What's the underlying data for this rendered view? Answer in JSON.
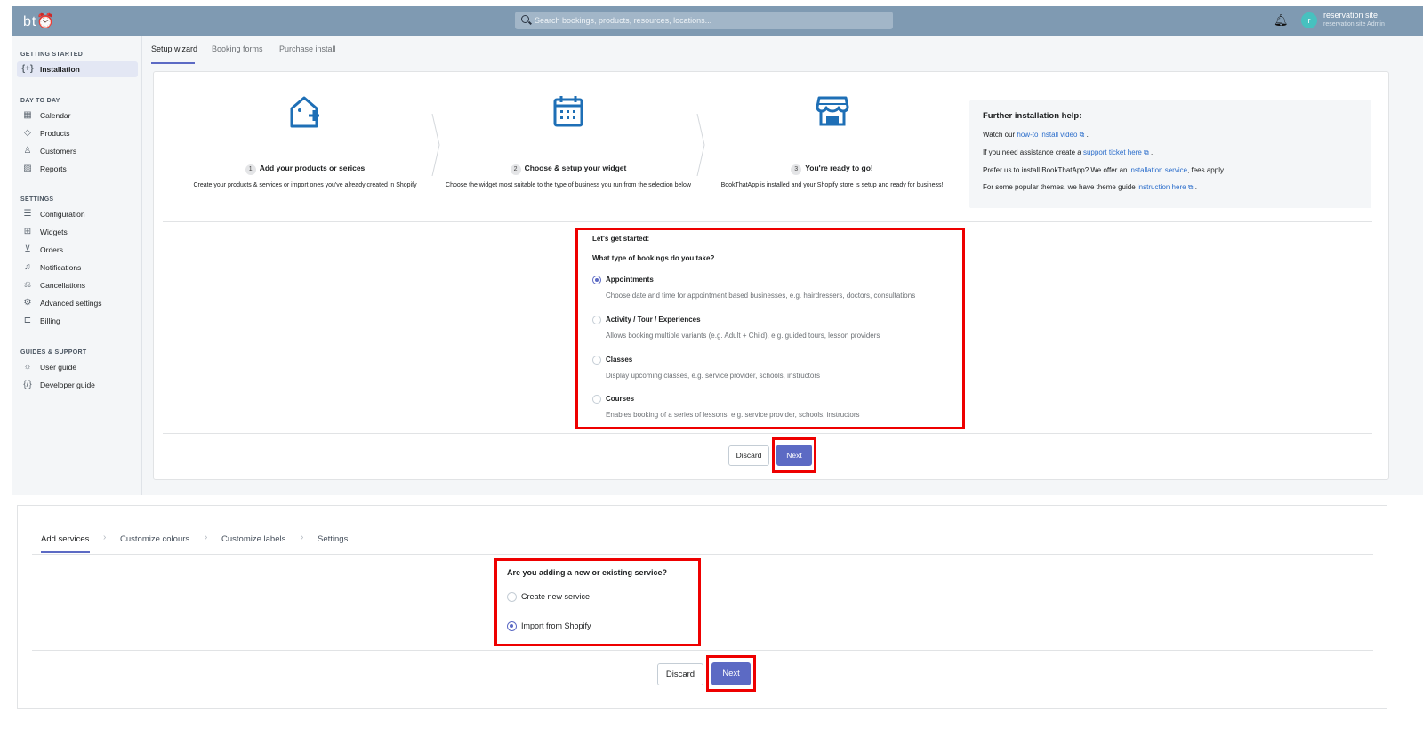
{
  "app": {
    "logo": "bt⏰",
    "search_placeholder": "Search bookings, products, resources, locations...",
    "user_initial": "r",
    "user_name": "reservation site",
    "user_role": "reservation site Admin"
  },
  "sidebar": {
    "sections": [
      {
        "title": "GETTING STARTED",
        "items": [
          {
            "label": "Installation",
            "icon": "brackets-plus-icon",
            "glyph": "{+}"
          }
        ]
      },
      {
        "title": "DAY TO DAY",
        "items": [
          {
            "label": "Calendar",
            "icon": "calendar-icon",
            "glyph": "▦"
          },
          {
            "label": "Products",
            "icon": "tag-icon",
            "glyph": "◇"
          },
          {
            "label": "Customers",
            "icon": "person-icon",
            "glyph": "♙"
          },
          {
            "label": "Reports",
            "icon": "chart-icon",
            "glyph": "▨"
          }
        ]
      },
      {
        "title": "SETTINGS",
        "items": [
          {
            "label": "Configuration",
            "icon": "sliders-icon",
            "glyph": "☰"
          },
          {
            "label": "Widgets",
            "icon": "widgets-icon",
            "glyph": "⊞"
          },
          {
            "label": "Orders",
            "icon": "download-box-icon",
            "glyph": "⊻"
          },
          {
            "label": "Notifications",
            "icon": "bell-icon",
            "glyph": "♫"
          },
          {
            "label": "Cancellations",
            "icon": "return-icon",
            "glyph": "⎌"
          },
          {
            "label": "Advanced settings",
            "icon": "gear-icon",
            "glyph": "⚙"
          },
          {
            "label": "Billing",
            "icon": "cart-icon",
            "glyph": "⊏"
          }
        ]
      },
      {
        "title": "GUIDES & SUPPORT",
        "items": [
          {
            "label": "User guide",
            "icon": "lightbulb-icon",
            "glyph": "☼"
          },
          {
            "label": "Developer guide",
            "icon": "code-icon",
            "glyph": "{/}"
          }
        ]
      }
    ]
  },
  "tabs": [
    "Setup wizard",
    "Booking forms",
    "Purchase install"
  ],
  "steps": [
    {
      "num": "1",
      "title": "Add your products or serices",
      "desc": "Create your products & services or import ones you've already created in Shopify"
    },
    {
      "num": "2",
      "title": "Choose & setup your widget",
      "desc": "Choose the widget most suitable to the type of business you run from the selection below"
    },
    {
      "num": "3",
      "title": "You're ready to go!",
      "desc": "BookThatApp is installed and your Shopify store is setup and ready for business!"
    }
  ],
  "help": {
    "title": "Further installation help:",
    "line1_pre": "Watch our ",
    "line1_link": "how-to install video",
    "line1_post": " .",
    "line2_pre": "If you need assistance create a ",
    "line2_link": "support ticket here",
    "line2_post": " .",
    "line3_pre": "Prefer us to install BookThatApp? We offer an ",
    "line3_link": "installation service",
    "line3_post": ", fees apply.",
    "line4_pre": "For some popular themes, we have theme guide ",
    "line4_link": "instruction here",
    "line4_post": " ."
  },
  "start": {
    "heading": "Let's get started:",
    "question": "What type of bookings do you take?",
    "options": [
      {
        "label": "Appointments",
        "desc": "Choose date and time for appointment based businesses, e.g. hairdressers, doctors, consultations",
        "selected": true
      },
      {
        "label": "Activity / Tour / Experiences",
        "desc": "Allows booking multiple variants (e.g. Adult + Child), e.g. guided tours, lesson providers",
        "selected": false
      },
      {
        "label": "Classes",
        "desc": "Display upcoming classes, e.g. service provider, schools, instructors",
        "selected": false
      },
      {
        "label": "Courses",
        "desc": "Enables booking of a series of lessons, e.g. service provider, schools, instructors",
        "selected": false
      }
    ]
  },
  "buttons": {
    "discard": "Discard",
    "next": "Next"
  },
  "wizard": {
    "tabs": [
      "Add services",
      "Customize colours",
      "Customize labels",
      "Settings"
    ],
    "question": "Are you adding a new or existing service?",
    "options": [
      {
        "label": "Create new service",
        "selected": false
      },
      {
        "label": "Import from Shopify",
        "selected": true
      }
    ]
  },
  "colors": {
    "accent": "#5c6ac4",
    "highlight": "#ee0000",
    "topbar": "#7f9ab2",
    "link": "#2c6ecb"
  }
}
